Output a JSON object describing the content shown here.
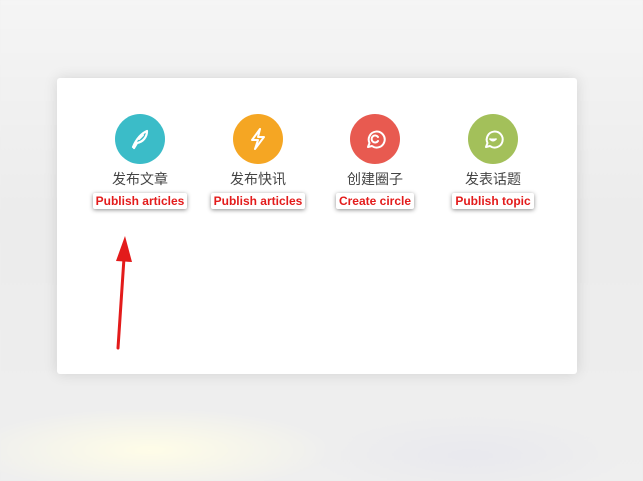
{
  "actions": [
    {
      "label": "发布文章",
      "annotation": "Publish articles",
      "icon": "feather-icon",
      "color": "#3bbcc8"
    },
    {
      "label": "发布快讯",
      "annotation": "Publish articles",
      "icon": "lightning-icon",
      "color": "#f5a623"
    },
    {
      "label": "创建圈子",
      "annotation": "Create circle",
      "icon": "circle-group-icon",
      "color": "#e85a50"
    },
    {
      "label": "发表话题",
      "annotation": "Publish topic",
      "icon": "chat-smile-icon",
      "color": "#a3c05a"
    }
  ],
  "annotation_color": "#e31b1b"
}
